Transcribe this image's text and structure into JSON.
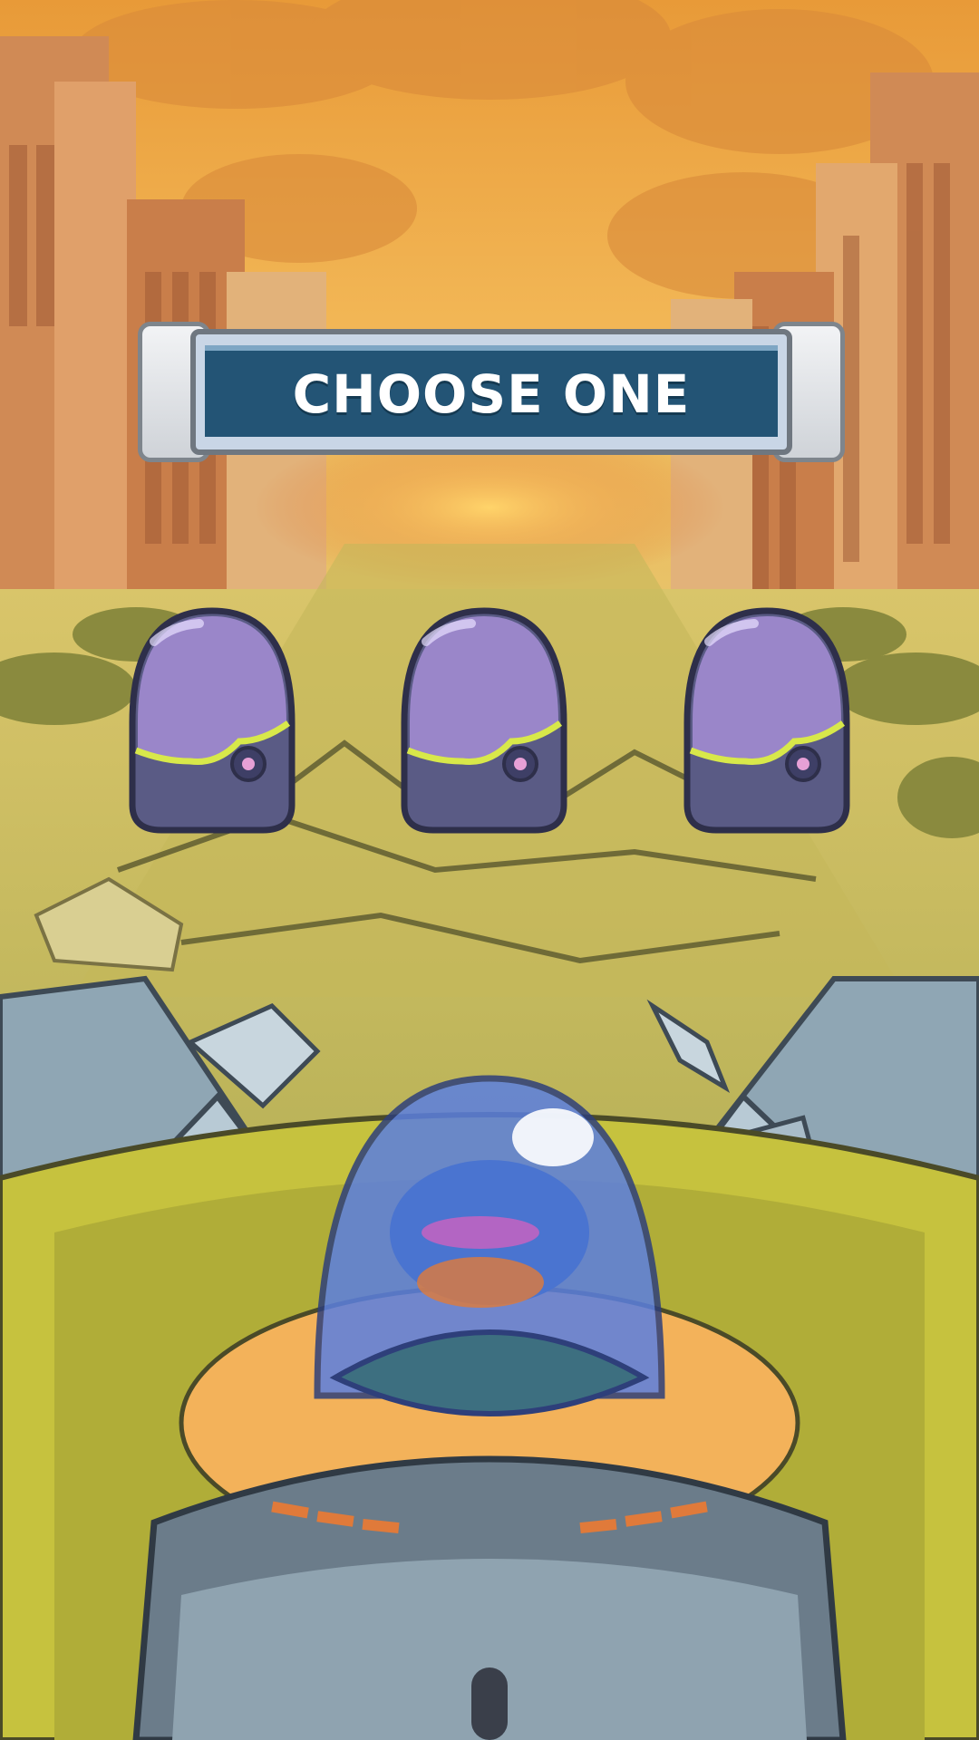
{
  "banner": {
    "title": "CHOOSE ONE"
  },
  "capsules": [
    {
      "name": "capsule-left"
    },
    {
      "name": "capsule-middle"
    },
    {
      "name": "capsule-right"
    }
  ],
  "colors": {
    "sky": "#f0a43a",
    "ground": "#b9b14a",
    "banner_fill": "#235475",
    "capsule_dome": "#9a86c9",
    "capsule_base": "#5a5b85",
    "capsule_stripe": "#d8e84a",
    "cockpit_glass": "#5b7fe0"
  }
}
